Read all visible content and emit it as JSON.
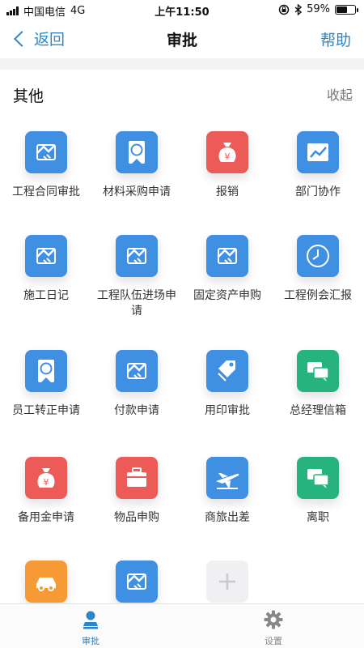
{
  "status_bar": {
    "carrier": "中国电信",
    "network": "4G",
    "time": "上午11:50",
    "battery": "59%",
    "battery_level": 0.59
  },
  "nav": {
    "back_label": "返回",
    "title": "审批",
    "help_label": "帮助"
  },
  "section": {
    "title": "其他",
    "collapse_label": "收起"
  },
  "items": [
    {
      "label": "工程合同审批",
      "icon": "handshake-icon",
      "color": "#3f8fe3"
    },
    {
      "label": "材料采购申请",
      "icon": "award-icon",
      "color": "#3f8fe3"
    },
    {
      "label": "报销",
      "icon": "money-bag-icon",
      "color": "#ec5b57"
    },
    {
      "label": "部门协作",
      "icon": "chart-icon",
      "color": "#3f8fe3"
    },
    {
      "label": "施工日记",
      "icon": "handshake-icon",
      "color": "#3f8fe3"
    },
    {
      "label": "工程队伍进场申请",
      "icon": "handshake-icon",
      "color": "#3f8fe3"
    },
    {
      "label": "固定资产申购",
      "icon": "handshake-icon",
      "color": "#3f8fe3"
    },
    {
      "label": "工程例会汇报",
      "icon": "clock-icon",
      "color": "#3f8fe3"
    },
    {
      "label": "员工转正申请",
      "icon": "award-icon",
      "color": "#3f8fe3"
    },
    {
      "label": "付款申请",
      "icon": "handshake-icon",
      "color": "#3f8fe3"
    },
    {
      "label": "用印审批",
      "icon": "tag-icon",
      "color": "#3f8fe3"
    },
    {
      "label": "总经理信箱",
      "icon": "chat-bubbles-icon",
      "color": "#27b37e"
    },
    {
      "label": "备用金申请",
      "icon": "money-bag-icon",
      "color": "#ec5b57"
    },
    {
      "label": "物品申购",
      "icon": "toolbox-icon",
      "color": "#ec5b57"
    },
    {
      "label": "商旅出差",
      "icon": "airplane-icon",
      "color": "#3f8fe3"
    },
    {
      "label": "离职",
      "icon": "chat-bubbles-icon",
      "color": "#27b37e"
    },
    {
      "label": "",
      "icon": "car-icon",
      "color": "#f59a34"
    },
    {
      "label": "",
      "icon": "handshake-icon",
      "color": "#3f8fe3"
    },
    {
      "label": "",
      "icon": "plus-icon",
      "color": "#f0f0f2"
    }
  ],
  "tabs": [
    {
      "label": "审批",
      "icon": "person-stamp-icon",
      "active": true,
      "color": "#2f86c6"
    },
    {
      "label": "设置",
      "icon": "gear-icon",
      "active": false,
      "color": "#888888"
    }
  ]
}
